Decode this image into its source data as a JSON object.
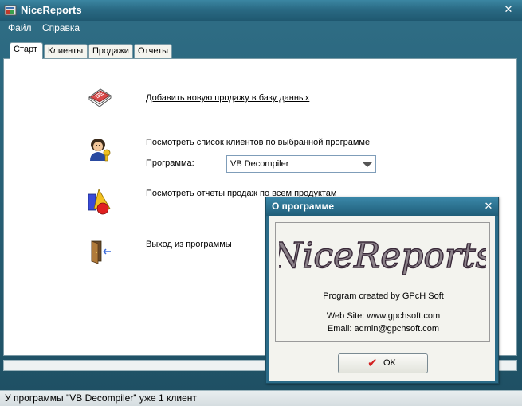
{
  "window": {
    "title": "NiceReports",
    "minimize_glyph": "_",
    "close_glyph": "✕"
  },
  "menu": {
    "items": [
      {
        "label": "Файл"
      },
      {
        "label": "Справка"
      }
    ]
  },
  "tabs": [
    {
      "label": "Старт",
      "active": true
    },
    {
      "label": "Клиенты"
    },
    {
      "label": "Продажи"
    },
    {
      "label": "Отчеты"
    }
  ],
  "actions": {
    "add_sale": {
      "label": "Добавить новую продажу в базу данных",
      "icon": "add-sale-book-icon"
    },
    "view_clients": {
      "label": "Посмотреть список клиентов по выбранной программе",
      "icon": "clients-key-icon"
    },
    "program_label": "Программа:",
    "program_value": "VB Decompiler",
    "view_reports": {
      "label": "Посмотреть отчеты продаж по всем продуктам",
      "icon": "reports-shapes-icon"
    },
    "exit": {
      "label": "Выход из программы",
      "icon": "exit-door-icon"
    }
  },
  "status": {
    "text": "У программы \"VB Decompiler\" уже 1 клиент"
  },
  "about_dialog": {
    "title": "О программе",
    "close_glyph": "✕",
    "logo_text": "NiceReports",
    "created_by": "Program created by GPcH Soft",
    "website": "Web Site: www.gpchsoft.com",
    "email": "Email: admin@gpchsoft.com",
    "ok_label": "OK",
    "ok_icon": "check-icon"
  },
  "colors": {
    "window_frame": "#2f6e86",
    "dialog_frame": "#2a6b88",
    "check_red": "#d22020"
  }
}
